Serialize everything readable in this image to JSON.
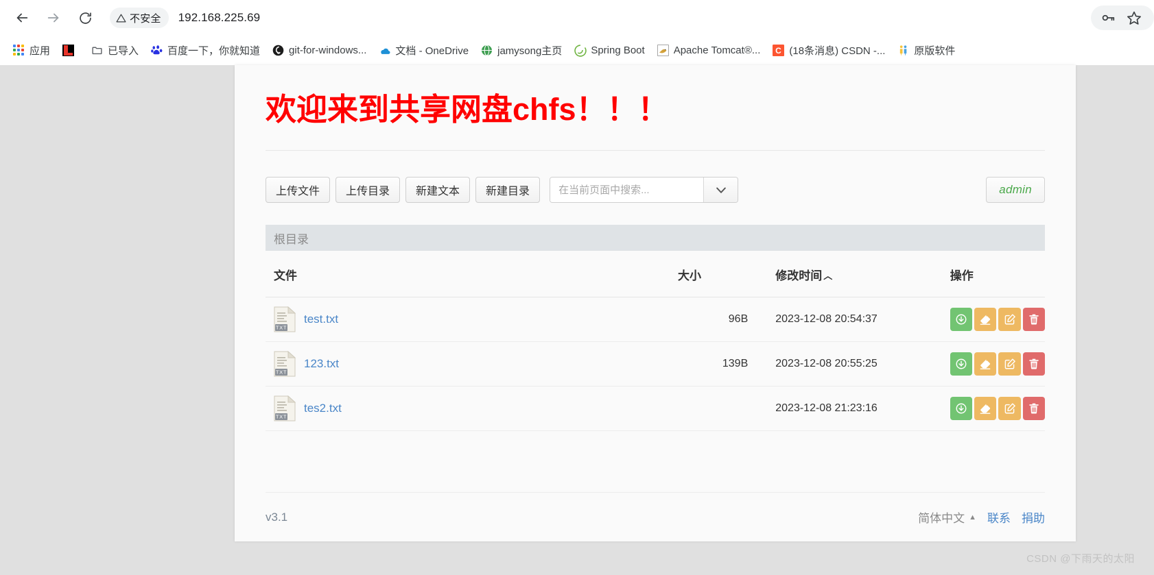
{
  "browser": {
    "nav": {
      "back_label": "Back",
      "forward_label": "Forward",
      "reload_label": "Reload"
    },
    "omnibox": {
      "security_label": "不安全",
      "url": "192.168.225.69",
      "actions": [
        "key-icon",
        "star-icon"
      ]
    },
    "bookmarks": [
      {
        "label": "应用",
        "icon": "apps-grid-icon"
      },
      {
        "label": "",
        "icon": "l-red-icon"
      },
      {
        "label": "已导入",
        "icon": "folder-icon"
      },
      {
        "label": "百度一下，你就知道",
        "icon": "baidu-icon"
      },
      {
        "label": "git-for-windows...",
        "icon": "git-icon"
      },
      {
        "label": "文档 - OneDrive",
        "icon": "onedrive-icon"
      },
      {
        "label": "jamysong主页",
        "icon": "globe-icon"
      },
      {
        "label": "Spring Boot",
        "icon": "spring-icon"
      },
      {
        "label": "Apache Tomcat®...",
        "icon": "tomcat-icon"
      },
      {
        "label": "(18条消息) CSDN -...",
        "icon": "csdn-icon"
      },
      {
        "label": "原版软件",
        "icon": "people-icon"
      }
    ]
  },
  "page": {
    "site_title": "欢迎来到共享网盘chfs！！！",
    "toolbar": {
      "buttons": [
        {
          "label": "上传文件",
          "name": "upload-file-button"
        },
        {
          "label": "上传目录",
          "name": "upload-folder-button"
        },
        {
          "label": "新建文本",
          "name": "new-text-button"
        },
        {
          "label": "新建目录",
          "name": "new-folder-button"
        }
      ],
      "search_placeholder": "在当前页面中搜索...",
      "search_value": "",
      "dropdown_icon": "chevron-down-icon",
      "user_badge": "admin"
    },
    "breadcrumb": {
      "current": "根目录"
    },
    "table": {
      "headers": {
        "name": "文件",
        "size": "大小",
        "mtime": "修改时间",
        "sort_caret": "︿",
        "ops": "操作"
      },
      "rows": [
        {
          "name": "test.txt",
          "icon": "txt-file-icon",
          "badge": "TXT",
          "size": "96B",
          "mtime": "2023-12-08 20:54:37",
          "ops": [
            "download-icon",
            "rename-icon",
            "edit-icon",
            "delete-icon"
          ]
        },
        {
          "name": "123.txt",
          "icon": "txt-file-icon",
          "badge": "TXT",
          "size": "139B",
          "mtime": "2023-12-08 20:55:25",
          "ops": [
            "download-icon",
            "rename-icon",
            "edit-icon",
            "delete-icon"
          ]
        },
        {
          "name": "tes2.txt",
          "icon": "txt-file-icon",
          "badge": "TXT",
          "size": "",
          "mtime": "2023-12-08 21:23:16",
          "ops": [
            "download-icon",
            "rename-icon",
            "edit-icon",
            "delete-icon"
          ]
        }
      ]
    },
    "footer": {
      "version": "v3.1",
      "language": "简体中文",
      "language_caret": "▲",
      "links": [
        {
          "label": "联系",
          "name": "contact-link"
        },
        {
          "label": "捐助",
          "name": "donate-link"
        }
      ]
    }
  },
  "watermark": "CSDN @下雨天的太阳",
  "colors": {
    "title_red": "#ff0000",
    "link_blue": "#4a86c8",
    "badge_green": "#4aa84a",
    "op_download": "#72c472",
    "op_rename": "#eeb962",
    "op_edit": "#eeb962",
    "op_delete": "#e06b6b",
    "page_bg": "#e0e0e0",
    "card_bg": "#fafafa",
    "breadcrumb_bg": "#dfe3e6"
  }
}
